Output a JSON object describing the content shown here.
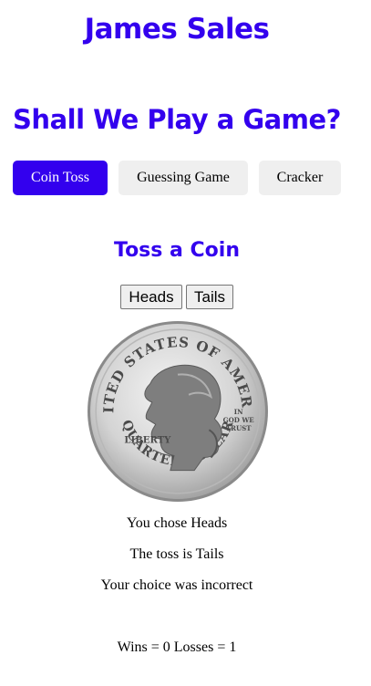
{
  "header": {
    "site_title": "James Sales",
    "page_heading": "Shall We Play a Game?"
  },
  "nav": {
    "items": [
      {
        "label": "Coin Toss",
        "active": true
      },
      {
        "label": "Guessing Game",
        "active": false
      },
      {
        "label": "Cracker",
        "active": false
      }
    ]
  },
  "game": {
    "title": "Toss a Coin",
    "heads_label": "Heads",
    "tails_label": "Tails",
    "coin": {
      "icon": "quarter-coin-icon",
      "top_text": "UNITED STATES OF AMERICA",
      "bottom_text": "QUARTER DOLLAR",
      "liberty_text": "LIBERTY",
      "motto": [
        "IN",
        "GOD WE",
        "TRUST"
      ]
    },
    "choice_text": "You chose Heads",
    "toss_text": "The toss is Tails",
    "result_text": "Your choice was incorrect",
    "score_text": "Wins = 0 Losses = 1"
  },
  "colors": {
    "accent": "#3300ee",
    "button_bg": "#efefef"
  }
}
